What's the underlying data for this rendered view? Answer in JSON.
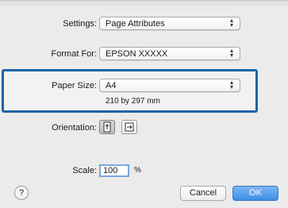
{
  "settings": {
    "label": "Settings:",
    "value": "Page Attributes"
  },
  "format_for": {
    "label": "Format For:",
    "value": "EPSON XXXXX"
  },
  "paper_size": {
    "label": "Paper Size:",
    "value": "A4",
    "dimensions": "210 by 297 mm"
  },
  "orientation": {
    "label": "Orientation:"
  },
  "scale": {
    "label": "Scale:",
    "value": "100",
    "unit": "%"
  },
  "buttons": {
    "help": "?",
    "cancel": "Cancel",
    "ok": "OK"
  },
  "colors": {
    "highlight": "#1f64a6",
    "ok_button": "#3d8de6"
  },
  "icons": {
    "popup_arrows": "updown-arrows-icon",
    "portrait": "portrait-orientation-icon",
    "landscape": "landscape-orientation-icon"
  }
}
